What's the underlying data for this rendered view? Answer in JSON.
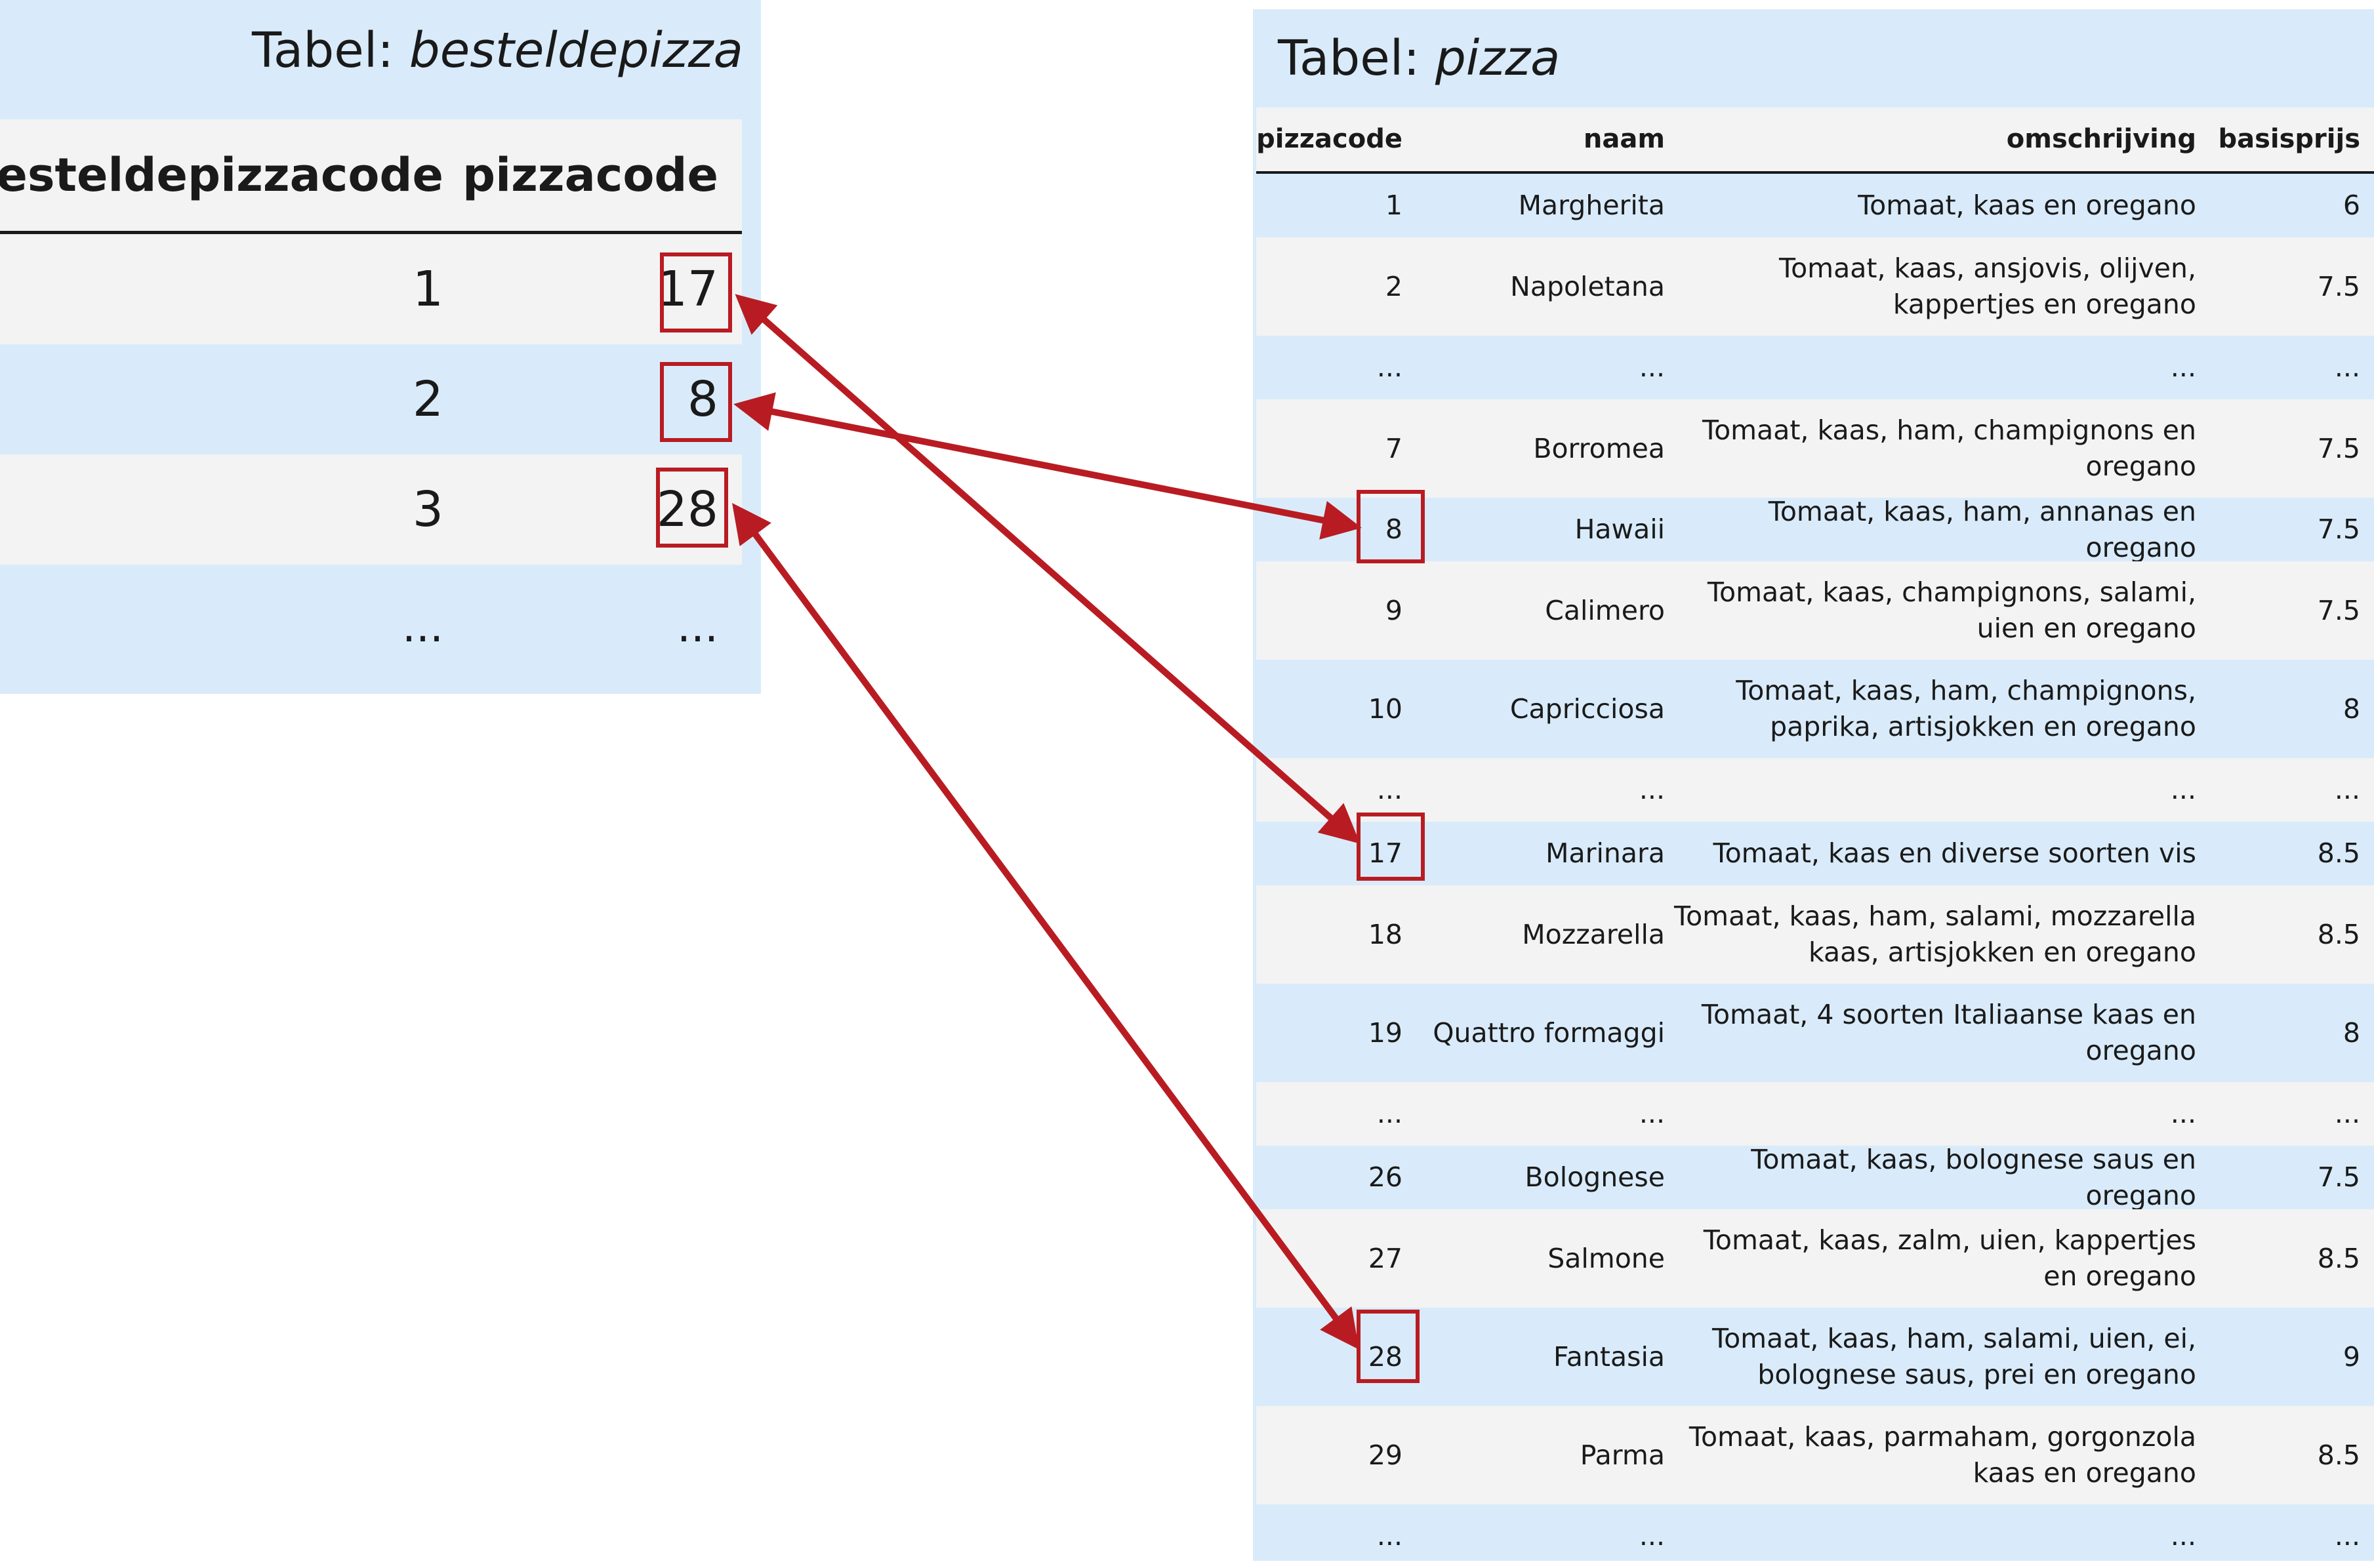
{
  "besteldepizza": {
    "title_prefix": "Tabel: ",
    "title_name": "besteldepizza",
    "headers": [
      "besteldepizzacode",
      "pizzacode"
    ],
    "rows": [
      [
        "1",
        "17"
      ],
      [
        "2",
        "8"
      ],
      [
        "3",
        "28"
      ],
      [
        "...",
        "..."
      ]
    ]
  },
  "pizza": {
    "title_prefix": "Tabel: ",
    "title_name": "pizza",
    "headers": [
      "pizzacode",
      "naam",
      "omschrijving",
      "basisprijs"
    ],
    "rows": [
      [
        "1",
        "Margherita",
        "Tomaat, kaas en oregano",
        "6"
      ],
      [
        "2",
        "Napoletana",
        "Tomaat, kaas, ansjovis, olijven, kappertjes en oregano",
        "7.5"
      ],
      [
        "...",
        "...",
        "...",
        "..."
      ],
      [
        "7",
        "Borromea",
        "Tomaat, kaas, ham, champignons en oregano",
        "7.5"
      ],
      [
        "8",
        "Hawaii",
        "Tomaat, kaas, ham, annanas en oregano",
        "7.5"
      ],
      [
        "9",
        "Calimero",
        "Tomaat, kaas, champignons, salami, uien en oregano",
        "7.5"
      ],
      [
        "10",
        "Capricciosa",
        "Tomaat, kaas, ham, champignons, paprika, artisjokken en oregano",
        "8"
      ],
      [
        "...",
        "...",
        "...",
        "..."
      ],
      [
        "17",
        "Marinara",
        "Tomaat, kaas en diverse soorten vis",
        "8.5"
      ],
      [
        "18",
        "Mozzarella",
        "Tomaat, kaas, ham, salami, mozzarella kaas, artisjokken en oregano",
        "8.5"
      ],
      [
        "19",
        "Quattro formaggi",
        "Tomaat, 4 soorten Italiaanse kaas en oregano",
        "8"
      ],
      [
        "...",
        "...",
        "...",
        "..."
      ],
      [
        "26",
        "Bolognese",
        "Tomaat, kaas, bolognese saus en oregano",
        "7.5"
      ],
      [
        "27",
        "Salmone",
        "Tomaat, kaas, zalm, uien, kappertjes en oregano",
        "8.5"
      ],
      [
        "28",
        "Fantasia",
        "Tomaat, kaas, ham, salami, uien, ei, bolognese saus, prei en oregano",
        "9"
      ],
      [
        "29",
        "Parma",
        "Tomaat, kaas, parmaham, gorgonzola kaas en oregano",
        "8.5"
      ],
      [
        "...",
        "...",
        "...",
        "..."
      ]
    ]
  },
  "links": [
    {
      "from": "17",
      "to": "17"
    },
    {
      "from": "8",
      "to": "8"
    },
    {
      "from": "28",
      "to": "28"
    }
  ],
  "colors": {
    "panel": "#d9ebfa",
    "row_alt": "#f3f3f3",
    "accent": "#b81c22"
  }
}
